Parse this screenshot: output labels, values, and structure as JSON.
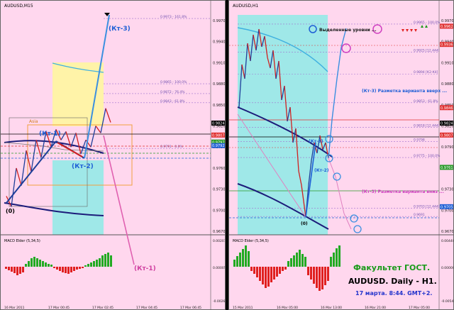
{
  "left_chart": {
    "symbol": "AUDUSD,M15",
    "price_ticks": [
      "0.9970",
      "0.9940",
      "0.9910",
      "0.9880",
      "0.9850",
      "0.9820",
      "0.9790",
      "0.9760",
      "0.9730",
      "0.9700",
      "0.9670"
    ],
    "price_flags": [
      {
        "text": "0.9824",
        "price": 0.9824,
        "color": "#000000"
      },
      {
        "text": "0.9807",
        "price": 0.9807,
        "color": "#e03030"
      },
      {
        "text": "0.9797",
        "price": 0.9797,
        "color": "#2a9a2a"
      },
      {
        "text": "0.9792",
        "price": 0.9792,
        "color": "#1f5fd6"
      }
    ],
    "fib_levels": [
      {
        "text": "0.9973 - 161.8%",
        "price": 0.9973
      },
      {
        "text": "0.9865 - 100.0%",
        "price": 0.988
      },
      {
        "text": "0.9872 - 76.4%",
        "price": 0.9866
      },
      {
        "text": "0.9843 - 61.8%",
        "price": 0.9853
      },
      {
        "text": "0.9791 - 0.0%",
        "price": 0.9788
      }
    ],
    "labels": {
      "kt1": "(Кт-1)",
      "kt2": "(Кт-2)",
      "kt3": "(Кт-3)",
      "kt1b": "(Кт-1)",
      "zero": "(0)",
      "asia": "Asia"
    },
    "time_labels": [
      "16 Mar 2011",
      "17 Mar 00:45",
      "17 Mar 02:45",
      "17 Mar 04:45",
      "17 Mar 06:45"
    ],
    "macd": {
      "title": "MACD Elder (5,34,5)",
      "ticks": [
        "0.00201",
        "0.00005",
        "-0.00268"
      ]
    },
    "ohlc": [
      [
        0.972,
        0.9705
      ],
      [
        0.9705,
        0.976
      ],
      [
        0.976,
        0.9735
      ],
      [
        0.9735,
        0.9785
      ],
      [
        0.9785,
        0.9755
      ],
      [
        0.9755,
        0.98
      ],
      [
        0.98,
        0.9775
      ],
      [
        0.9775,
        0.9812
      ],
      [
        0.9812,
        0.979
      ],
      [
        0.979,
        0.9815
      ],
      [
        0.9815,
        0.98
      ],
      [
        0.98,
        0.9812
      ],
      [
        0.9812,
        0.979
      ],
      [
        0.979,
        0.981
      ],
      [
        0.981,
        0.978
      ],
      [
        0.978,
        0.98
      ],
      [
        0.98,
        0.979
      ],
      [
        0.979,
        0.982
      ],
      [
        0.982,
        0.981
      ],
      [
        0.981,
        0.9845
      ],
      [
        0.9845,
        0.9825
      ]
    ]
  },
  "right_chart": {
    "symbol": "AUDUSD,H1",
    "price_ticks": [
      "0.9970",
      "0.9940",
      "0.9910",
      "0.9880",
      "0.9850",
      "0.9820",
      "0.9790",
      "0.9760",
      "0.9730",
      "0.9700",
      "0.9670"
    ],
    "price_flags": [
      {
        "text": "0.9962",
        "price": 0.9962,
        "color": "#e03030"
      },
      {
        "text": "0.9936",
        "price": 0.9936,
        "color": "#e03030"
      },
      {
        "text": "0.9846",
        "price": 0.9846,
        "color": "#e03030"
      },
      {
        "text": "0.9824",
        "price": 0.9824,
        "color": "#000000"
      },
      {
        "text": "0.9807",
        "price": 0.9807,
        "color": "#e03030"
      },
      {
        "text": "0.9761",
        "price": 0.9761,
        "color": "#2a9a2a"
      },
      {
        "text": "0.9705",
        "price": 0.9705,
        "color": "#1f5fd6"
      }
    ],
    "fib_levels": [
      {
        "text": "0.9965 - 100.0%",
        "price": 0.9965
      },
      {
        "text": "0.9925 [12.444]",
        "price": 0.9925
      },
      {
        "text": "0.9894 [К2-К4]",
        "price": 0.9894
      },
      {
        "text": "0.9853 - 61.8%",
        "price": 0.9853
      },
      {
        "text": "0.9818 [12.444]",
        "price": 0.9818
      },
      {
        "text": "0.9798",
        "price": 0.9798
      },
      {
        "text": "0.9775 - 100.0%",
        "price": 0.9775
      },
      {
        "text": "0.9703 [12.444]",
        "price": 0.9703
      },
      {
        "text": "0.9691",
        "price": 0.9691
      }
    ],
    "annotations": {
      "selected_levels": "Выделенные уровни ...",
      "variant_up": "(Кт-3) Разметка варианта вверх ...",
      "variant_down": "(Кт-3) Разметка варианта вниз ...",
      "kt3": "(Кт-3)",
      "kt2": "(Кт-2)",
      "zero": "(0)"
    },
    "time_labels": [
      "15 Mar 2011",
      "16 Mar 05:00",
      "16 Mar 13:00",
      "16 Mar 21:00",
      "17 Mar 05:00"
    ],
    "macd": {
      "title": "MACD Elder (5,34,5)",
      "ticks": [
        "0.00440",
        "0.00000",
        "-0.00549"
      ]
    },
    "footer": {
      "line1": "Факультет ГОСТ.",
      "line2": "AUDUSD. Daily - H1.",
      "line3": "17 марта. 8:44. GMT+2."
    }
  },
  "colors": {
    "bg": "#ffd7ee",
    "cyan_zone": "#9fe8e8",
    "yellow_zone": "#fff3a8",
    "up_bar": "#22aa22",
    "down_bar": "#e02020",
    "footer_green": "#1a9a1a",
    "footer_blue": "#2233cc"
  }
}
